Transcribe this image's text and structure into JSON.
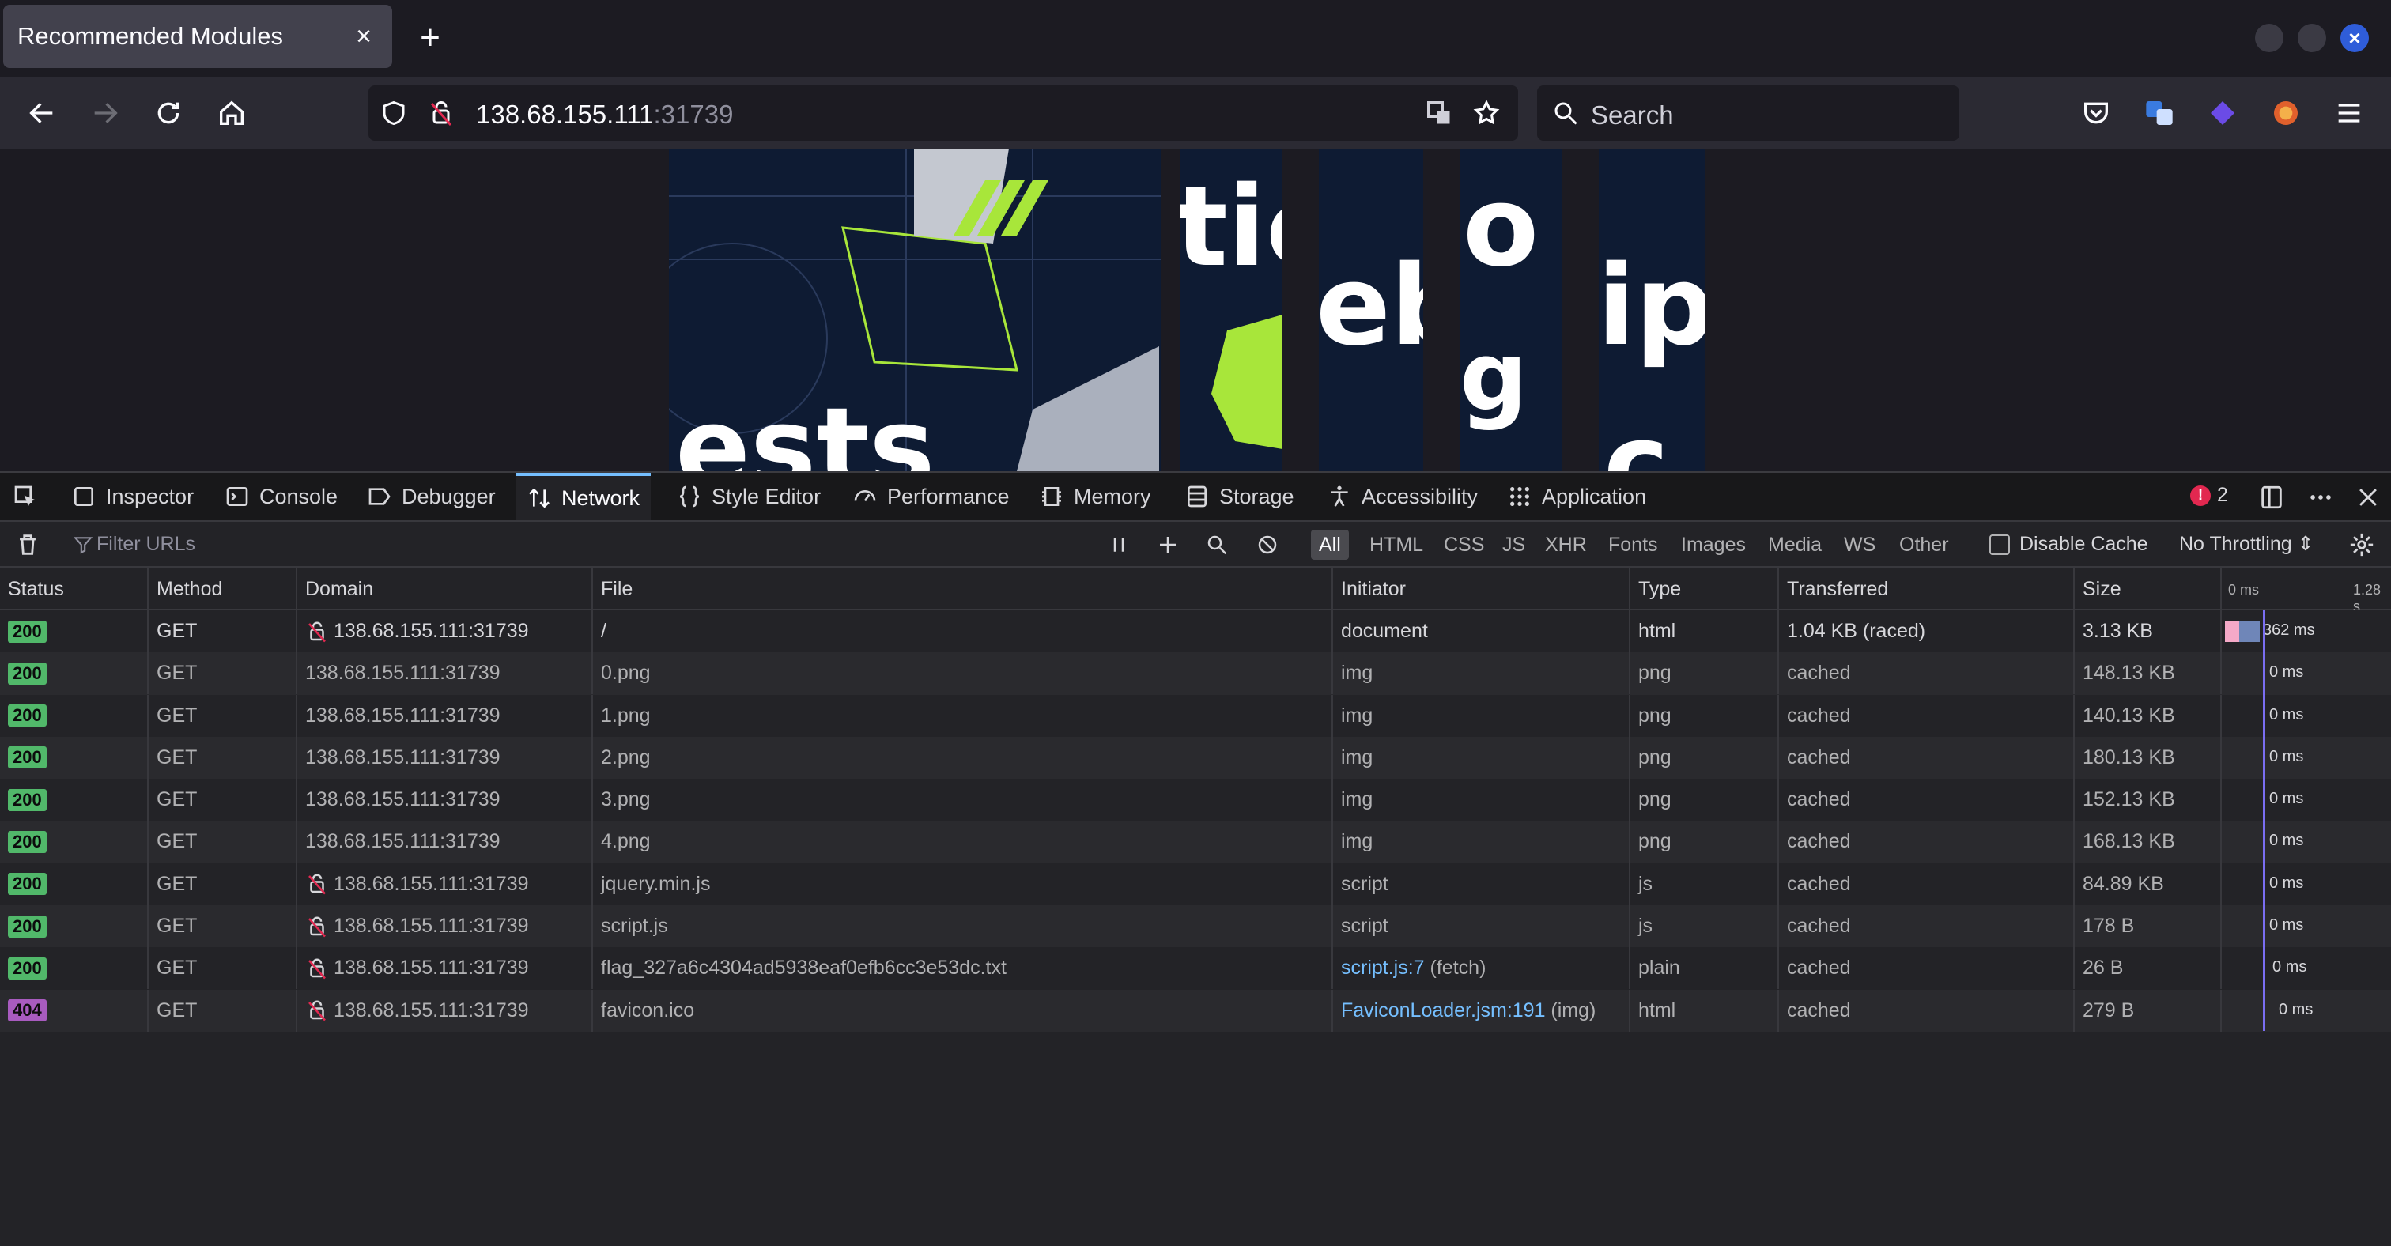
{
  "browser": {
    "tab_title": "Recommended Modules",
    "tab_close": "×",
    "new_tab": "+",
    "url_host": "138.68.155.111",
    "url_port": ":31739",
    "search_placeholder": "Search"
  },
  "page": {
    "tiles": [
      {
        "text": "ests"
      },
      {
        "text": "tic"
      },
      {
        "text": "eb"
      },
      {
        "text": "o"
      },
      {
        "text": "ip"
      }
    ],
    "tile_text_2": "g",
    "tile_text_3": "c"
  },
  "devtools": {
    "tabs": [
      {
        "label": "Inspector"
      },
      {
        "label": "Console"
      },
      {
        "label": "Debugger"
      },
      {
        "label": "Network"
      },
      {
        "label": "Style Editor"
      },
      {
        "label": "Performance"
      },
      {
        "label": "Memory"
      },
      {
        "label": "Storage"
      },
      {
        "label": "Accessibility"
      },
      {
        "label": "Application"
      }
    ],
    "selected_tab": "Network",
    "error_count": "2",
    "error_icon": "!",
    "filter_placeholder": "Filter URLs",
    "filter_types": [
      "All",
      "HTML",
      "CSS",
      "JS",
      "XHR",
      "Fonts",
      "Images",
      "Media",
      "WS",
      "Other"
    ],
    "disable_cache_label": "Disable Cache",
    "throttling_label": "No Throttling ⇕",
    "columns": {
      "status": "Status",
      "method": "Method",
      "domain": "Domain",
      "file": "File",
      "initiator": "Initiator",
      "type": "Type",
      "transferred": "Transferred",
      "size": "Size",
      "waterfall_start": "0 ms",
      "waterfall_end": "1.28 s"
    },
    "requests": [
      {
        "status": "200",
        "method": "GET",
        "domain": "138.68.155.111:31739",
        "tracker": true,
        "file": "/",
        "initiator": "document",
        "initiator_suffix": "",
        "type": "html",
        "transferred": "1.04 KB (raced)",
        "size": "3.13 KB",
        "time": "362 ms"
      },
      {
        "status": "200",
        "method": "GET",
        "domain": "138.68.155.111:31739",
        "tracker": false,
        "file": "0.png",
        "initiator": "img",
        "initiator_suffix": "",
        "type": "png",
        "transferred": "cached",
        "size": "148.13 KB",
        "time": "0 ms"
      },
      {
        "status": "200",
        "method": "GET",
        "domain": "138.68.155.111:31739",
        "tracker": false,
        "file": "1.png",
        "initiator": "img",
        "initiator_suffix": "",
        "type": "png",
        "transferred": "cached",
        "size": "140.13 KB",
        "time": "0 ms"
      },
      {
        "status": "200",
        "method": "GET",
        "domain": "138.68.155.111:31739",
        "tracker": false,
        "file": "2.png",
        "initiator": "img",
        "initiator_suffix": "",
        "type": "png",
        "transferred": "cached",
        "size": "180.13 KB",
        "time": "0 ms"
      },
      {
        "status": "200",
        "method": "GET",
        "domain": "138.68.155.111:31739",
        "tracker": false,
        "file": "3.png",
        "initiator": "img",
        "initiator_suffix": "",
        "type": "png",
        "transferred": "cached",
        "size": "152.13 KB",
        "time": "0 ms"
      },
      {
        "status": "200",
        "method": "GET",
        "domain": "138.68.155.111:31739",
        "tracker": false,
        "file": "4.png",
        "initiator": "img",
        "initiator_suffix": "",
        "type": "png",
        "transferred": "cached",
        "size": "168.13 KB",
        "time": "0 ms"
      },
      {
        "status": "200",
        "method": "GET",
        "domain": "138.68.155.111:31739",
        "tracker": true,
        "file": "jquery.min.js",
        "initiator": "script",
        "initiator_suffix": "",
        "type": "js",
        "transferred": "cached",
        "size": "84.89 KB",
        "time": "0 ms"
      },
      {
        "status": "200",
        "method": "GET",
        "domain": "138.68.155.111:31739",
        "tracker": true,
        "file": "script.js",
        "initiator": "script",
        "initiator_suffix": "",
        "type": "js",
        "transferred": "cached",
        "size": "178 B",
        "time": "0 ms"
      },
      {
        "status": "200",
        "method": "GET",
        "domain": "138.68.155.111:31739",
        "tracker": true,
        "file": "flag_327a6c4304ad5938eaf0efb6cc3e53dc.txt",
        "initiator": "script.js:7",
        "initiator_suffix": " (fetch)",
        "type": "plain",
        "transferred": "cached",
        "size": "26 B",
        "time": "0 ms"
      },
      {
        "status": "404",
        "method": "GET",
        "domain": "138.68.155.111:31739",
        "tracker": true,
        "file": "favicon.ico",
        "initiator": "FaviconLoader.jsm:191",
        "initiator_suffix": " (img)",
        "type": "html",
        "transferred": "cached",
        "size": "279 B",
        "time": "0 ms"
      }
    ]
  },
  "colors": {
    "accent": "#75bfff",
    "status_ok": "#51b86a",
    "status_404": "#a85bbf",
    "tile_bg": "#0e1b33",
    "tile_green": "#a8e63a"
  }
}
